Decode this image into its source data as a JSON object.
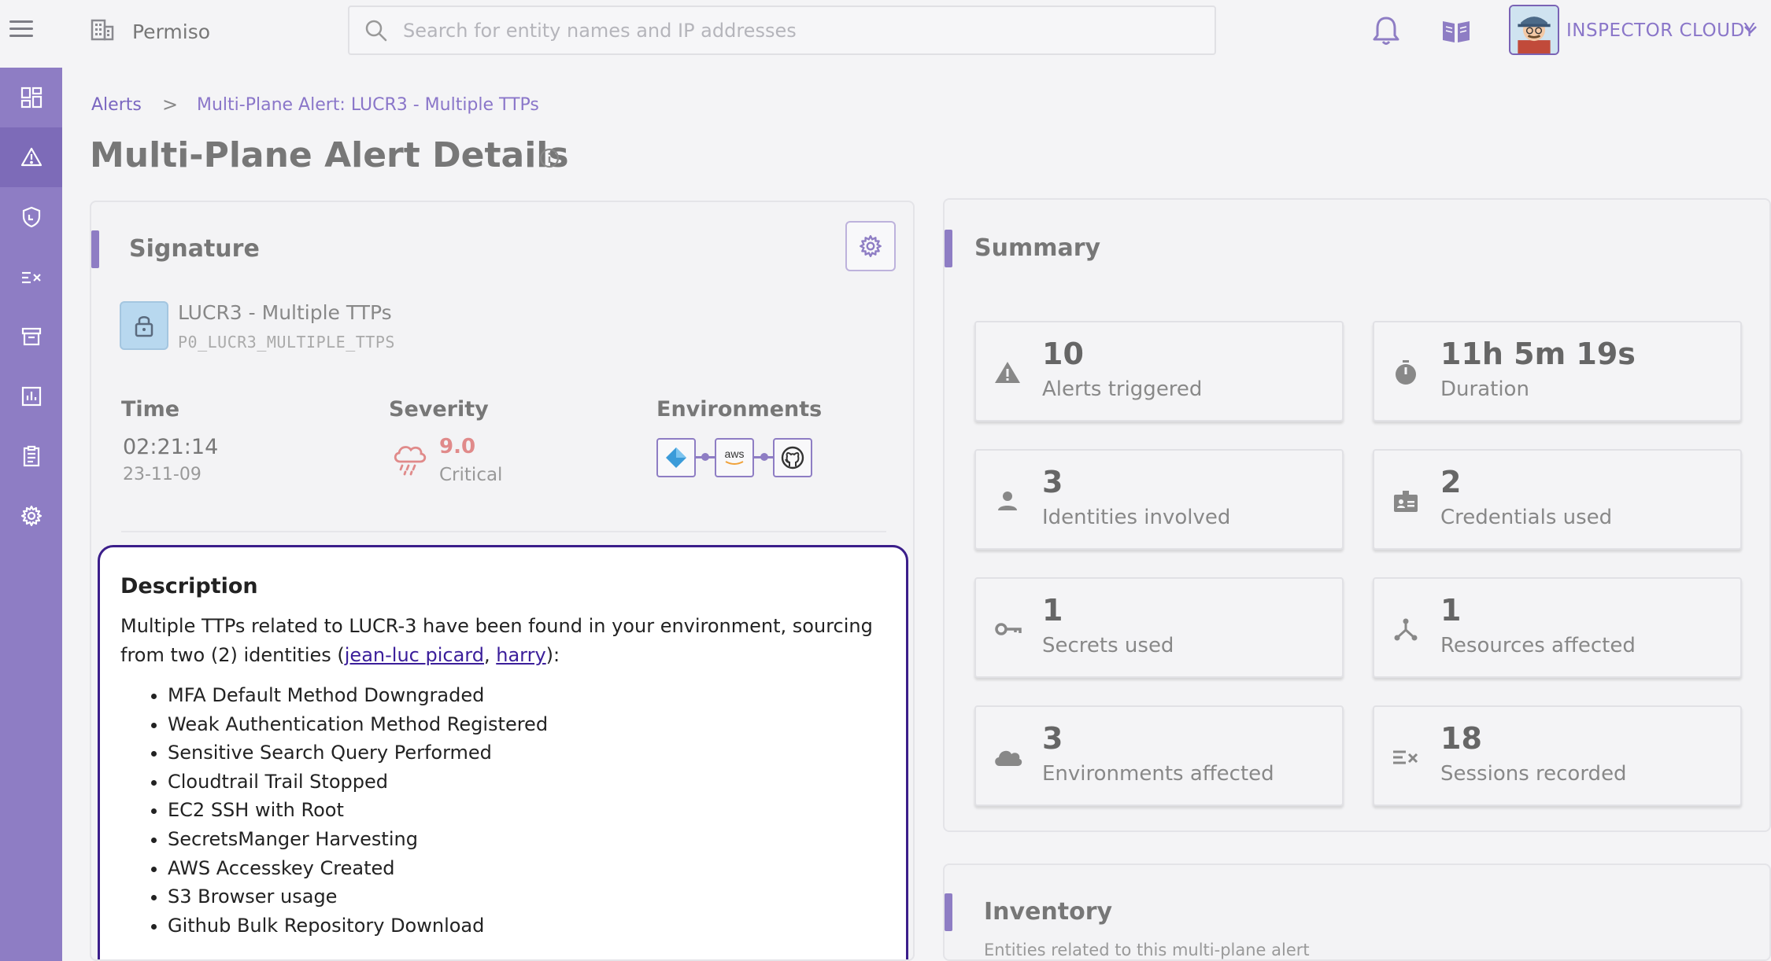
{
  "header": {
    "org_name": "Permiso",
    "search_placeholder": "Search for entity names and IP addresses",
    "user_name": "INSPECTOR CLOUDY"
  },
  "sidebar": {
    "items": [
      {
        "icon": "dashboard-icon",
        "active": false
      },
      {
        "icon": "alert-icon",
        "active": true
      },
      {
        "icon": "shield-icon",
        "active": false
      },
      {
        "icon": "sessions-icon",
        "active": false
      },
      {
        "icon": "archive-icon",
        "active": false
      },
      {
        "icon": "chart-icon",
        "active": false
      },
      {
        "icon": "clipboard-icon",
        "active": false
      },
      {
        "icon": "gear-icon",
        "active": false
      }
    ]
  },
  "breadcrumb": {
    "root": "Alerts",
    "separator": ">",
    "current": "Multi-Plane Alert: LUCR3 - Multiple TTPs"
  },
  "page_title": "Multi-Plane Alert Details",
  "signature": {
    "title": "Signature",
    "name": "LUCR3 - Multiple TTPs",
    "code": "P0_LUCR3_MULTIPLE_TTPS",
    "time_label": "Time",
    "time": "02:21:14",
    "date": "23-11-09",
    "severity_label": "Severity",
    "severity_score": "9.0",
    "severity_level": "Critical",
    "environments_label": "Environments",
    "environments": [
      {
        "icon": "azure-icon",
        "text": ""
      },
      {
        "icon": "aws-icon",
        "text": "aws"
      },
      {
        "icon": "github-icon",
        "text": ""
      }
    ],
    "description": {
      "title": "Description",
      "text_before": "Multiple TTPs related to LUCR-3 have been found in your environment, sourcing from two (2) identities (",
      "link1": "jean-luc picard",
      "comma": ", ",
      "link2": "harry",
      "text_after": "):",
      "items": [
        "MFA Default Method Downgraded",
        "Weak Authentication Method Registered",
        "Sensitive Search Query Performed",
        "Cloudtrail Trail Stopped",
        "EC2 SSH with Root",
        "SecretsManger Harvesting",
        "AWS Accesskey Created",
        "S3 Browser usage",
        "Github Bulk Repository Download"
      ]
    }
  },
  "summary": {
    "title": "Summary",
    "stats": [
      {
        "value": "10",
        "label": "Alerts triggered",
        "icon": "warning-icon"
      },
      {
        "value": "11h 5m 19s",
        "label": "Duration",
        "icon": "stopwatch-icon"
      },
      {
        "value": "3",
        "label": "Identities involved",
        "icon": "person-icon"
      },
      {
        "value": "2",
        "label": "Credentials used",
        "icon": "badge-icon"
      },
      {
        "value": "1",
        "label": "Secrets used",
        "icon": "key-icon"
      },
      {
        "value": "1",
        "label": "Resources affected",
        "icon": "resource-icon"
      },
      {
        "value": "3",
        "label": "Environments affected",
        "icon": "cloud-icon"
      },
      {
        "value": "18",
        "label": "Sessions recorded",
        "icon": "sessions-icon"
      }
    ]
  },
  "inventory": {
    "title": "Inventory",
    "subtitle": "Entities related to this multi-plane alert"
  },
  "colors": {
    "accent": "#8e7dc4",
    "sidebar_active": "#7d6bb8",
    "critical": "#e08a8a",
    "link": "#3b1e9a"
  }
}
